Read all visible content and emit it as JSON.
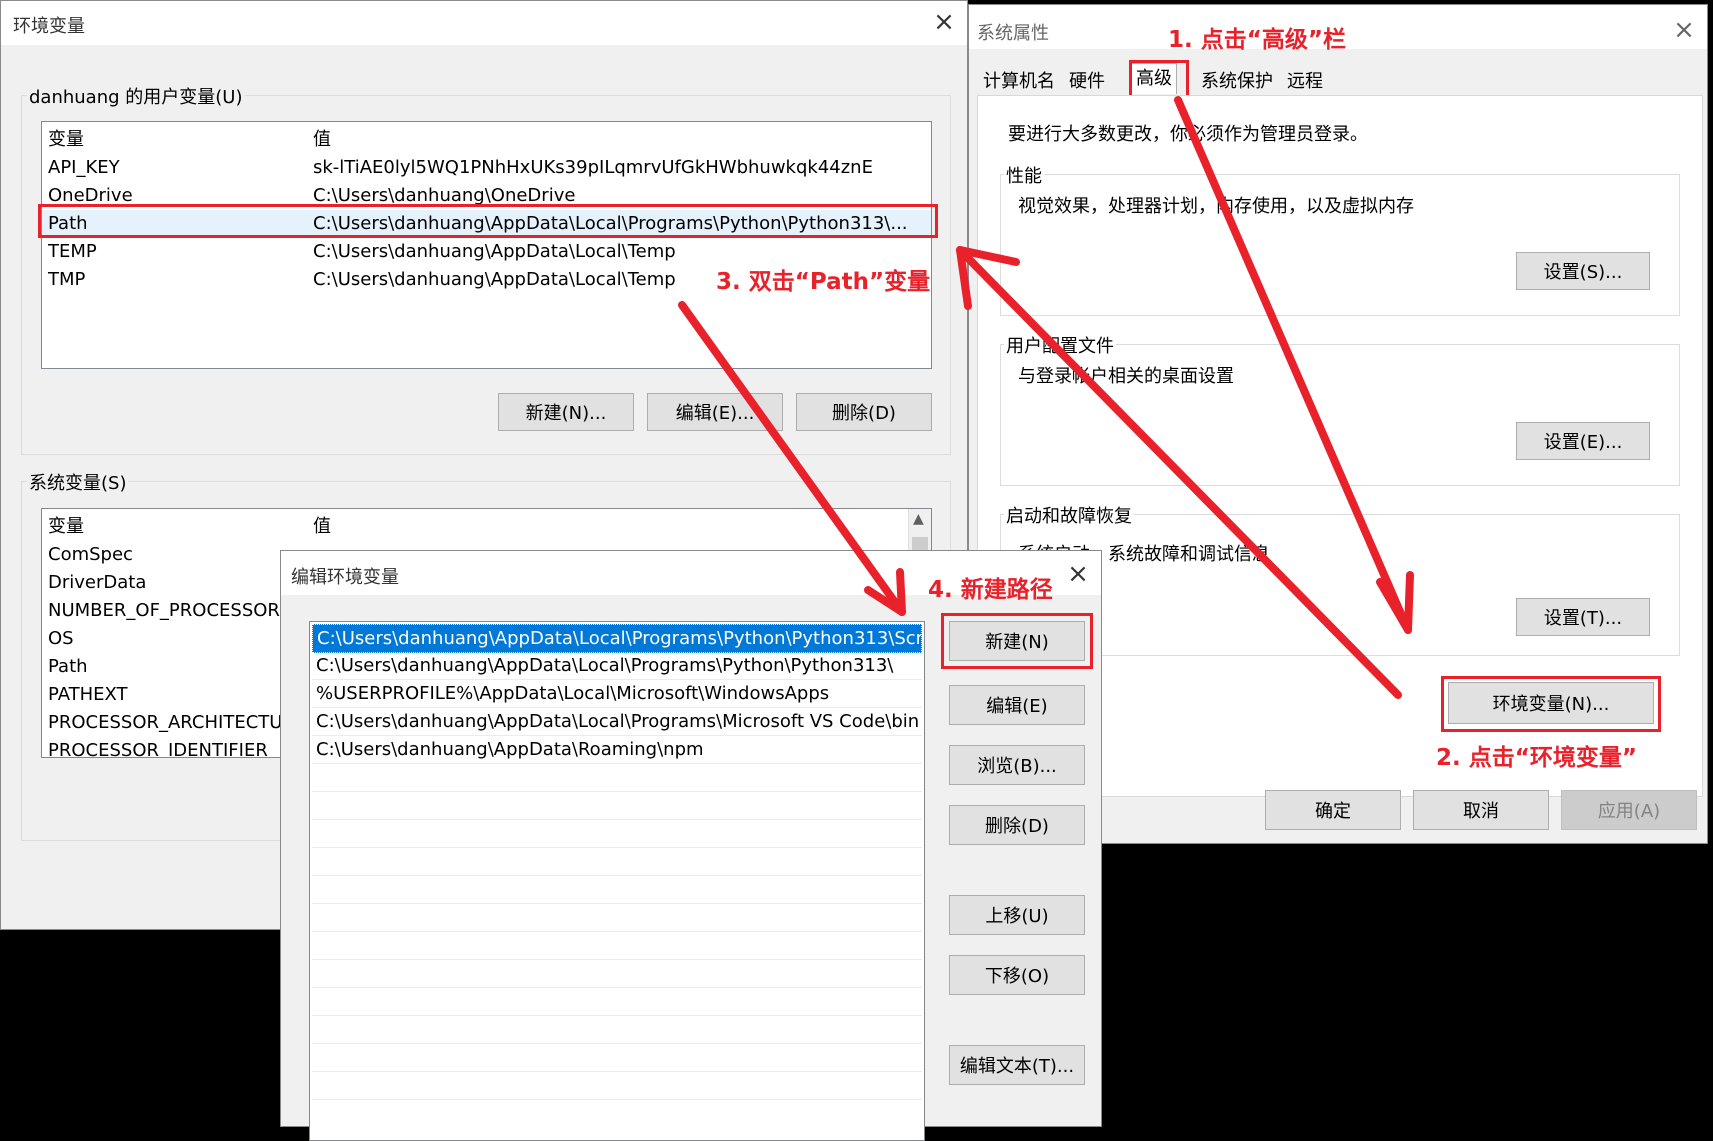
{
  "env_window": {
    "title": "环境变量",
    "user_group_label": "danhuang 的用户变量(U)",
    "columns": [
      "变量",
      "值"
    ],
    "user_vars": [
      {
        "name": "API_KEY",
        "value": "sk-lTiAE0lyl5WQ1PNhHxUKs39pILqmrvUfGkHWbhuwkqk44znE"
      },
      {
        "name": "OneDrive",
        "value": "C:\\Users\\danhuang\\OneDrive"
      },
      {
        "name": "Path",
        "value": "C:\\Users\\danhuang\\AppData\\Local\\Programs\\Python\\Python313\\..."
      },
      {
        "name": "TEMP",
        "value": "C:\\Users\\danhuang\\AppData\\Local\\Temp"
      },
      {
        "name": "TMP",
        "value": "C:\\Users\\danhuang\\AppData\\Local\\Temp"
      }
    ],
    "user_buttons": {
      "new": "新建(N)...",
      "edit": "编辑(E)...",
      "delete": "删除(D)"
    },
    "system_group_label": "系统变量(S)",
    "system_vars": [
      "ComSpec",
      "DriverData",
      "NUMBER_OF_PROCESSORS",
      "OS",
      "Path",
      "PATHEXT",
      "PROCESSOR_ARCHITECTURE",
      "PROCESSOR_IDENTIFIER"
    ]
  },
  "sys_props": {
    "title": "系统属性",
    "tabs": [
      "计算机名",
      "硬件",
      "高级",
      "系统保护",
      "远程"
    ],
    "admin_note": "要进行大多数更改，你必须作为管理员登录。",
    "performance": {
      "label": "性能",
      "desc": "视觉效果，处理器计划，内存使用，以及虚拟内存",
      "button": "设置(S)..."
    },
    "user_profile": {
      "label": "用户配置文件",
      "desc": "与登录帐户相关的桌面设置",
      "button": "设置(E)..."
    },
    "startup": {
      "label": "启动和故障恢复",
      "desc": "系统启动、系统故障和调试信息",
      "button": "设置(T)..."
    },
    "env_button": "环境变量(N)...",
    "ok": "确定",
    "cancel": "取消",
    "apply": "应用(A)"
  },
  "edit_env": {
    "title": "编辑环境变量",
    "entries": [
      "C:\\Users\\danhuang\\AppData\\Local\\Programs\\Python\\Python313\\Scr...",
      "C:\\Users\\danhuang\\AppData\\Local\\Programs\\Python\\Python313\\",
      "%USERPROFILE%\\AppData\\Local\\Microsoft\\WindowsApps",
      "C:\\Users\\danhuang\\AppData\\Local\\Programs\\Microsoft VS Code\\bin",
      "C:\\Users\\danhuang\\AppData\\Roaming\\npm"
    ],
    "buttons": {
      "new": "新建(N)",
      "edit": "编辑(E)",
      "browse": "浏览(B)...",
      "delete": "删除(D)",
      "up": "上移(U)",
      "down": "下移(O)",
      "edit_text": "编辑文本(T)..."
    }
  },
  "annotations": {
    "step1": "1. 点击“高级”栏",
    "step2": "2. 点击“环境变量”",
    "step3": "3. 双击“Path”变量",
    "step4": "4. 新建路径"
  },
  "colors": {
    "annotation_red": "#e8212a",
    "selection_blue": "#0078d7",
    "dialog_bg": "#f0f0f0"
  }
}
